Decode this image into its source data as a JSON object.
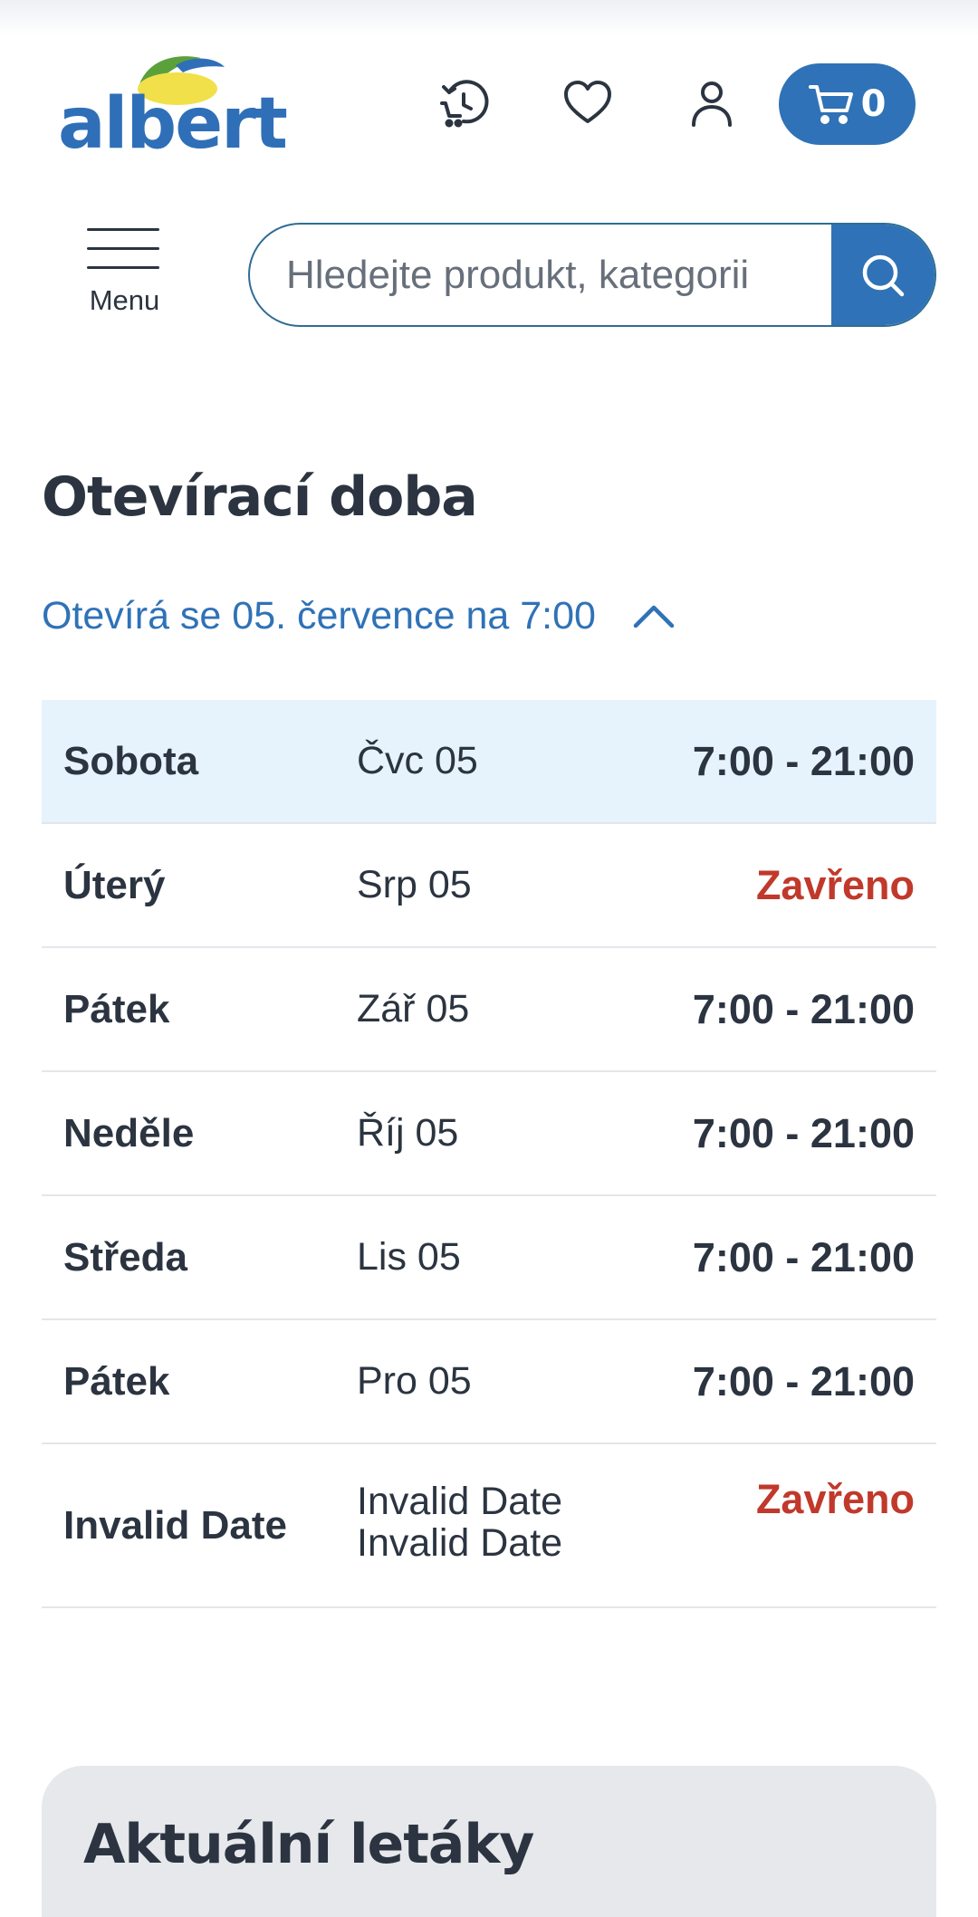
{
  "header": {
    "logo_text": "albert",
    "cart_count": "0"
  },
  "menu": {
    "label": "Menu"
  },
  "search": {
    "placeholder": "Hledejte produkt, kategorii"
  },
  "opening_hours": {
    "title": "Otevírací doba",
    "status": "Otevírá se 05. července na 7:00",
    "rows": [
      {
        "day": "Sobota",
        "date": "Čvc 05",
        "hours": "7:00 - 21:00"
      },
      {
        "day": "Úterý",
        "date": "Srp 05",
        "hours": "Zavřeno"
      },
      {
        "day": "Pátek",
        "date": "Zář 05",
        "hours": "7:00 - 21:00"
      },
      {
        "day": "Neděle",
        "date": "Říj 05",
        "hours": "7:00 - 21:00"
      },
      {
        "day": "Středa",
        "date": "Lis 05",
        "hours": "7:00 - 21:00"
      },
      {
        "day": "Pátek",
        "date": "Pro 05",
        "hours": "7:00 - 21:00"
      },
      {
        "day": "Invalid Date",
        "date": "Invalid Date Invalid Date",
        "hours": "Zavřeno"
      }
    ]
  },
  "flyers": {
    "title": "Aktuální letáky"
  },
  "colors": {
    "brand_blue": "#2f72b7",
    "today_highlight": "#e6f3fc",
    "closed_red": "#c0392b"
  },
  "icons": {
    "reorder": "history-cart-icon",
    "favorites": "heart-icon",
    "account": "user-icon",
    "cart": "cart-icon",
    "search": "search-icon",
    "menu": "hamburger-icon",
    "toggle": "chevron-up-icon"
  }
}
